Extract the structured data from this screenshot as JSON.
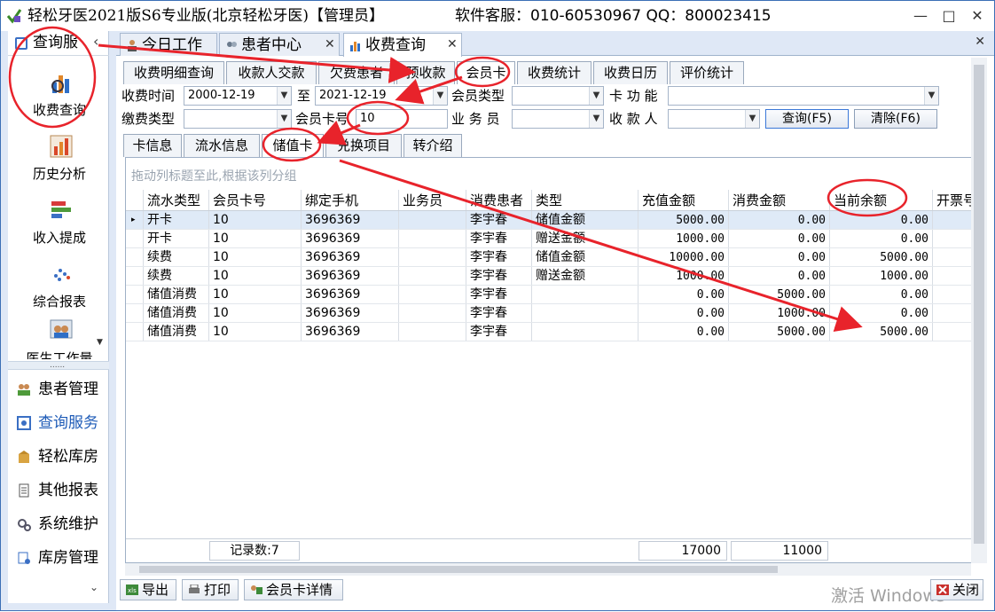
{
  "titlebar": {
    "title": "轻松牙医2021版S6专业版(北京轻松牙医)【管理员】",
    "support": "软件客服：010-60530967 QQ：800023415",
    "minimize": "—",
    "maximize": "□",
    "close": "✕"
  },
  "leftnav": {
    "header": "查询服",
    "collapse": "‹",
    "tiles": [
      {
        "label": "收费查询"
      },
      {
        "label": "历史分析"
      },
      {
        "label": "收入提成"
      },
      {
        "label": "综合报表"
      },
      {
        "label": "医生工作量"
      }
    ],
    "sep": "......",
    "items": [
      {
        "label": "患者管理"
      },
      {
        "label": "查询服务"
      },
      {
        "label": "轻松库房"
      },
      {
        "label": "其他报表"
      },
      {
        "label": "系统维护"
      },
      {
        "label": "库房管理"
      }
    ],
    "more": "⌄"
  },
  "doc_tabs": [
    {
      "label": "今日工作",
      "close": ""
    },
    {
      "label": "患者中心",
      "close": "✕"
    },
    {
      "label": "收费查询",
      "close": "✕"
    }
  ],
  "close_all": "✕",
  "subtabs": [
    "收费明细查询",
    "收款人交款",
    "欠费患者",
    "预收款",
    "会员卡",
    "收费统计",
    "收费日历",
    "评价统计"
  ],
  "filters": {
    "charge_time_label": "收费时间",
    "date_from": "2000-12-19",
    "to_label": "至",
    "date_to": "2021-12-19",
    "member_type_label": "会员类型",
    "member_type_value": "",
    "card_function_label": "卡 功 能",
    "card_function_value": "",
    "pay_type_label": "缴费类型",
    "pay_type_value": "",
    "card_no_label": "会员卡号",
    "card_no_value": "10",
    "salesman_label": "业 务 员",
    "salesman_value": "",
    "payee_label": "收 款 人",
    "payee_value": "",
    "query_btn": "查询(F5)",
    "clear_btn": "清除(F6)",
    "dropdown": "▼"
  },
  "inner_tabs": [
    "卡信息",
    "流水信息",
    "储值卡",
    "兑换项目",
    "转介绍"
  ],
  "grid": {
    "group_hint": "拖动列标题至此,根据该列分组",
    "columns": [
      "流水类型",
      "会员卡号",
      "绑定手机",
      "业务员",
      "消费患者",
      "类型",
      "充值金额",
      "消费金额",
      "当前余额",
      "开票号"
    ],
    "rows": [
      [
        "开卡",
        "10",
        "3696369",
        "",
        "李宇春",
        "储值金额",
        "5000.00",
        "0.00",
        "0.00",
        ""
      ],
      [
        "开卡",
        "10",
        "3696369",
        "",
        "李宇春",
        "赠送金额",
        "1000.00",
        "0.00",
        "0.00",
        ""
      ],
      [
        "续费",
        "10",
        "3696369",
        "",
        "李宇春",
        "储值金额",
        "10000.00",
        "0.00",
        "5000.00",
        ""
      ],
      [
        "续费",
        "10",
        "3696369",
        "",
        "李宇春",
        "赠送金额",
        "1000.00",
        "0.00",
        "1000.00",
        ""
      ],
      [
        "储值消费",
        "10",
        "3696369",
        "",
        "李宇春",
        "",
        "0.00",
        "5000.00",
        "0.00",
        ""
      ],
      [
        "储值消费",
        "10",
        "3696369",
        "",
        "李宇春",
        "",
        "0.00",
        "1000.00",
        "0.00",
        ""
      ],
      [
        "储值消费",
        "10",
        "3696369",
        "",
        "李宇春",
        "",
        "0.00",
        "5000.00",
        "5000.00",
        ""
      ]
    ],
    "row_indicator": "▸",
    "footer": {
      "record_count": "记录数:7",
      "recharge_total": "17000",
      "consume_total": "11000"
    }
  },
  "bottom": {
    "export": "导出",
    "print": "打印",
    "card_detail": "会员卡详情",
    "watermark": "激活 Windows",
    "close": "关闭"
  },
  "colors": {
    "annotation": "#e8232b",
    "accent": "#1e5bb7"
  }
}
